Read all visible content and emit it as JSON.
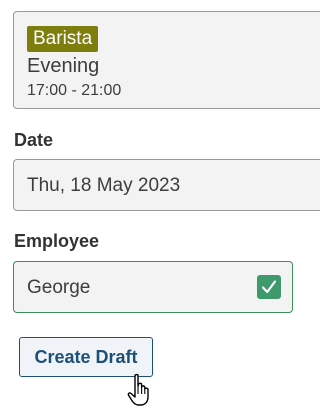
{
  "shift": {
    "role": "Barista",
    "name": "Evening",
    "time": "17:00 - 21:00"
  },
  "date": {
    "label": "Date",
    "value": "Thu, 18 May 2023"
  },
  "employee": {
    "label": "Employee",
    "value": "George",
    "valid_icon": "check-icon"
  },
  "actions": {
    "create_label": "Create Draft"
  },
  "colors": {
    "role_badge": "#7e7e0e",
    "valid_border": "#3e8e5a",
    "valid_check": "#3e9a6a",
    "button_text": "#1d4f77"
  }
}
